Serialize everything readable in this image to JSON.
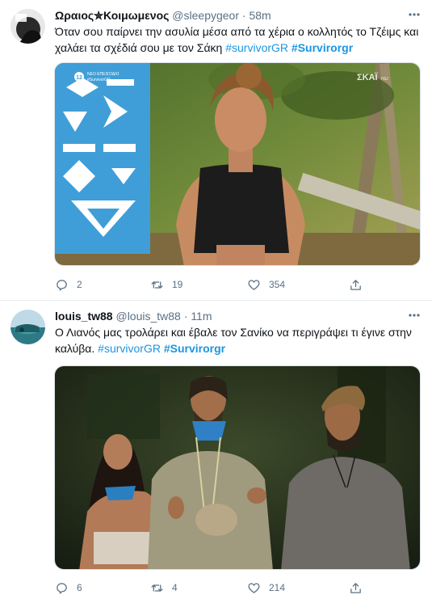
{
  "tweets": [
    {
      "author_name": "Ωραιος✮Κοιμωμενος",
      "handle": "@sleepygeor",
      "separator": "·",
      "time": "58m",
      "text_plain": "Όταν σου παίρνει την ασυλία μέσα από τα χέρια ο κολλητός το Τζέιμς και χαλάει τα σχέδιά σου με τον Σάκη ",
      "hashtag_1": "#survivorGR",
      "hashtag_2": "#Survirorgr",
      "media_badge_number": "12",
      "media_badge_text_1": "ΝΕΟ ΕΠΕΙΣΟΔΙΟ",
      "media_badge_text_2": "#SurvivorGR",
      "media_watermark": "ΣΚΑΪ",
      "media_watermark_suffix": "HD",
      "replies": "2",
      "retweets": "19",
      "likes": "354"
    },
    {
      "author_name": "louis_tw88",
      "handle": "@louis_tw88",
      "separator": "·",
      "time": "11m",
      "text_plain": "Ο Λιανός μας τρολάρει και έβαλε τον Σανίκο να περιγράψει τι έγινε στην καλύβα. ",
      "hashtag_1": "#survivorGR",
      "hashtag_2": "#Survirorgr",
      "replies": "6",
      "retweets": "4",
      "likes": "214"
    }
  ],
  "colors": {
    "link": "#1b95e0",
    "muted": "#5b7083",
    "text": "#0f1419",
    "divider": "#e6ecf0"
  },
  "icons": {
    "more": "more-horizontal-icon",
    "reply": "reply-bubble-icon",
    "retweet": "retweet-arrows-icon",
    "like": "heart-icon",
    "share": "share-upload-icon"
  }
}
